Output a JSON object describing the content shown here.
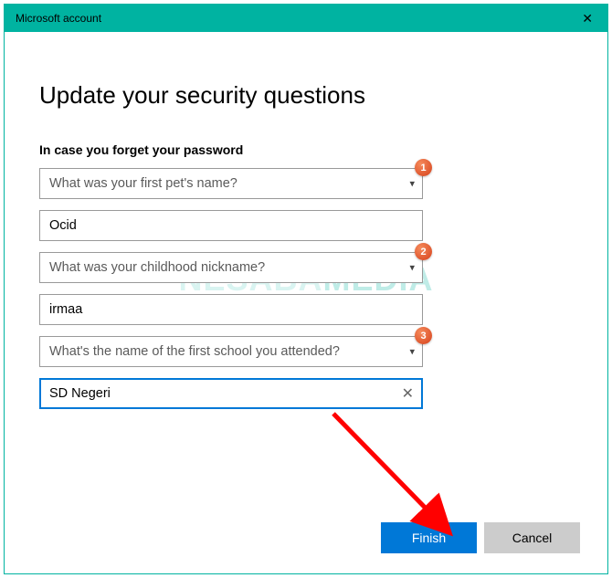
{
  "titlebar": {
    "title": "Microsoft account"
  },
  "page": {
    "heading": "Update your security questions",
    "subheading": "In case you forget your password"
  },
  "questions": {
    "q1": {
      "label": "What was your first pet's name?",
      "answer": "Ocid",
      "badge": "1"
    },
    "q2": {
      "label": "What was your childhood nickname?",
      "answer": "irmaa",
      "badge": "2"
    },
    "q3": {
      "label": "What's the name of the first school you attended?",
      "answer": "SD Negeri",
      "badge": "3"
    }
  },
  "buttons": {
    "finish": "Finish",
    "cancel": "Cancel"
  },
  "watermark": {
    "part1": "NESABA",
    "part2": "MEDIA"
  }
}
